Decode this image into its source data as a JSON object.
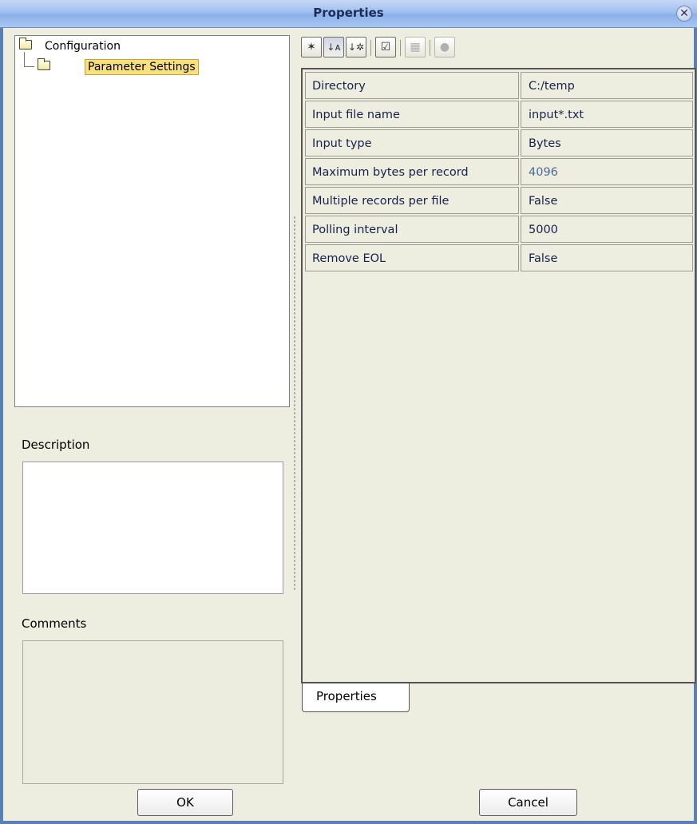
{
  "window": {
    "title": "Properties"
  },
  "tree": {
    "root_label": "Configuration",
    "child_label": "Parameter Settings"
  },
  "description": {
    "label": "Description",
    "value": ""
  },
  "comments": {
    "label": "Comments",
    "value": ""
  },
  "toolbar": {
    "buttons": [
      {
        "icon": "expand-icon",
        "glyph": "⊻"
      },
      {
        "icon": "sort-alpha-icon",
        "glyph": "↓ᴬz"
      },
      {
        "icon": "sort-category-icon",
        "glyph": "↓⁂"
      },
      {
        "icon": "checklist-icon",
        "glyph": "☑"
      },
      {
        "icon": "grid-icon",
        "glyph": "▦"
      },
      {
        "icon": "help-icon",
        "glyph": "●"
      }
    ]
  },
  "properties": [
    {
      "name": "Directory",
      "value": "C:/temp"
    },
    {
      "name": "Input file name",
      "value": "input*.txt"
    },
    {
      "name": "Input type",
      "value": "Bytes"
    },
    {
      "name": "Maximum bytes per record",
      "value": "4096"
    },
    {
      "name": "Multiple records per file",
      "value": "False"
    },
    {
      "name": "Polling interval",
      "value": "5000"
    },
    {
      "name": "Remove EOL",
      "value": "False"
    }
  ],
  "tab": {
    "label": "Properties"
  },
  "buttons": {
    "ok": "OK",
    "cancel": "Cancel"
  }
}
